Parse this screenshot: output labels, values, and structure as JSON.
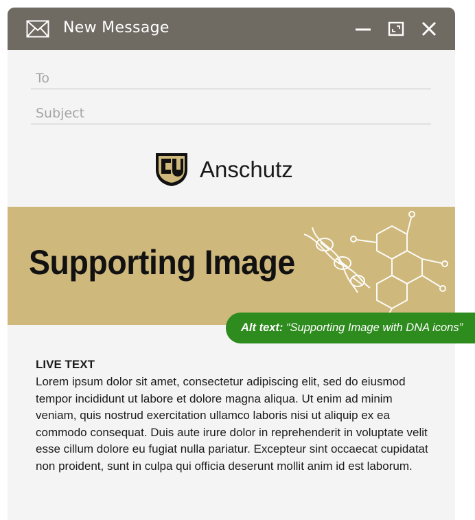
{
  "window": {
    "title": "New Message",
    "icons": {
      "mail": "envelope-icon",
      "minimize": "minimize-icon",
      "maximize": "maximize-icon",
      "close": "close-icon"
    }
  },
  "compose": {
    "to_placeholder": "To",
    "subject_placeholder": "Subject"
  },
  "email": {
    "logo_text": "Anschutz",
    "banner_headline": "Supporting Image",
    "banner_color": "#cfb87c",
    "alt_text_label": "Alt text:",
    "alt_text_value": "“Supporting Image with DNA icons”",
    "alt_text_color": "#2e8b1e",
    "live_text_heading": "LIVE TEXT",
    "live_text_body": "Lorem ipsum dolor sit amet, consectetur adipiscing elit, sed do eiusmod tempor incididunt ut labore et dolore magna aliqua. Ut enim ad minim veniam, quis nostrud exercitation ullamco laboris nisi ut aliquip ex ea commodo consequat. Duis aute irure dolor in reprehenderit in voluptate velit esse cillum dolore eu fugiat nulla pariatur. Excepteur sint occaecat cupidatat non proident, sunt in culpa qui officia deserunt mollit anim id est laborum."
  }
}
